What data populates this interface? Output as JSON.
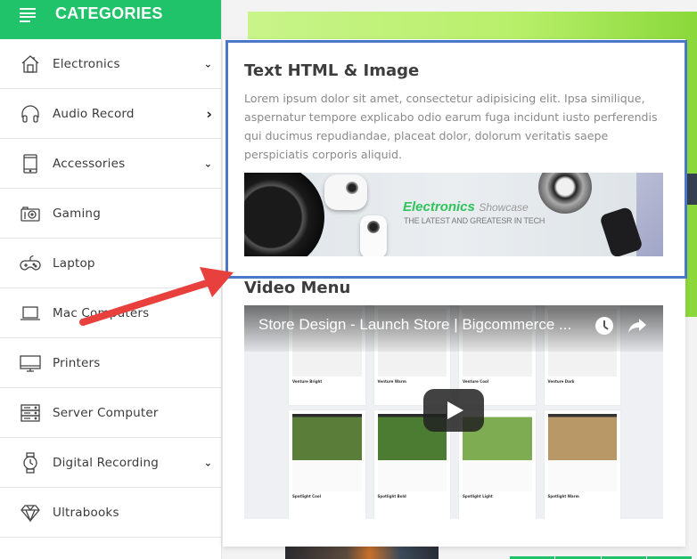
{
  "sidebar": {
    "title": "CATEGORIES",
    "items": [
      {
        "label": "Electronics",
        "icon": "home-icon",
        "chevron": "down"
      },
      {
        "label": "Audio Record",
        "icon": "headphones-icon",
        "chevron": "right"
      },
      {
        "label": "Accessories",
        "icon": "tablet-icon",
        "chevron": "down"
      },
      {
        "label": "Gaming",
        "icon": "camera-icon",
        "chevron": ""
      },
      {
        "label": "Laptop",
        "icon": "gamepad-icon",
        "chevron": ""
      },
      {
        "label": "Mac Computers",
        "icon": "laptop-icon",
        "chevron": ""
      },
      {
        "label": "Printers",
        "icon": "monitor-icon",
        "chevron": ""
      },
      {
        "label": "Server Computer",
        "icon": "server-icon",
        "chevron": ""
      },
      {
        "label": "Digital Recording",
        "icon": "watch-icon",
        "chevron": "down"
      },
      {
        "label": "Ultrabooks",
        "icon": "diamond-icon",
        "chevron": ""
      }
    ],
    "chevron_glyphs": {
      "down": "⌄",
      "right": "›"
    }
  },
  "mega_menu": {
    "text_section": {
      "title": "Text HTML & Image",
      "body": "Lorem ipsum dolor sit amet, consectetur adipisicing elit. Ipsa similique, aspernatur tempore explicabo odio earum fuga incidunt iusto perferendis qui ducimus repudiandae, placeat dolor, dolorum veritatis saepe perspiciatis corporis aliquid."
    },
    "promo_banner": {
      "brand": "Electronics",
      "brand_suffix": "Showcase",
      "tagline": "THE LATEST AND GREATESR IN TECH",
      "brand_color": "#2ec45a"
    },
    "video_section": {
      "title": "Video Menu",
      "video_title": "Store Design - Launch Store | Bigcommerce ...",
      "tiles": [
        "Venture Bright",
        "Venture Warm",
        "Venture Cool",
        "Venture Dark",
        "Spotlight Cool",
        "Spotlight Bold",
        "Spotlight Light",
        "Spotlight Warm"
      ]
    }
  },
  "colors": {
    "accent_green": "#21c36a",
    "highlight_blue": "#4a77c8",
    "annotation_arrow": "#e8403d"
  }
}
